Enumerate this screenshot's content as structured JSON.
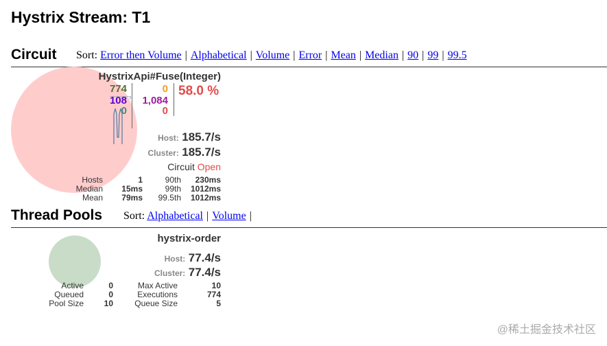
{
  "page_title": "Hystrix Stream: T1",
  "circuit_section": {
    "title": "Circuit",
    "sort_label": "Sort:",
    "sort_options": [
      "Error then Volume",
      "Alphabetical",
      "Volume",
      "Error",
      "Mean",
      "Median",
      "90",
      "99",
      "99.5"
    ]
  },
  "circuit": {
    "name": "HystrixApi#Fuse(Integer)",
    "success": "774",
    "short_circuited": "108",
    "bad_request": "0",
    "timeout": "0",
    "rejected": "1,084",
    "failure": "0",
    "error_rate": "58.0 %",
    "host_label": "Host:",
    "host_rate": "185.7/s",
    "cluster_label": "Cluster:",
    "cluster_rate": "185.7/s",
    "status_label": "Circuit",
    "status_value": "Open",
    "stats": {
      "hosts_label": "Hosts",
      "hosts": "1",
      "median_label": "Median",
      "median": "15ms",
      "mean_label": "Mean",
      "mean": "79ms",
      "p90_label": "90th",
      "p90": "230ms",
      "p99_label": "99th",
      "p99": "1012ms",
      "p995_label": "99.5th",
      "p995": "1012ms"
    },
    "colors": {
      "success": "#556b2f",
      "short_circuited": "#5a00d4",
      "bad_request": "#3d8f7a",
      "timeout": "#f0a020",
      "rejected": "#9e1b9e",
      "failure": "#e34b4b",
      "circle": "#ffcccc"
    }
  },
  "thread_pools_section": {
    "title": "Thread Pools",
    "sort_label": "Sort:",
    "sort_options": [
      "Alphabetical",
      "Volume"
    ]
  },
  "thread_pool": {
    "name": "hystrix-order",
    "host_label": "Host:",
    "host_rate": "77.4/s",
    "cluster_label": "Cluster:",
    "cluster_rate": "77.4/s",
    "stats": {
      "active_label": "Active",
      "active": "0",
      "queued_label": "Queued",
      "queued": "0",
      "pool_size_label": "Pool Size",
      "pool_size": "10",
      "max_active_label": "Max Active",
      "max_active": "10",
      "executions_label": "Executions",
      "executions": "774",
      "queue_size_label": "Queue Size",
      "queue_size": "5"
    },
    "colors": {
      "circle": "#c8dcc8"
    }
  },
  "watermark": "@稀土掘金技术社区"
}
